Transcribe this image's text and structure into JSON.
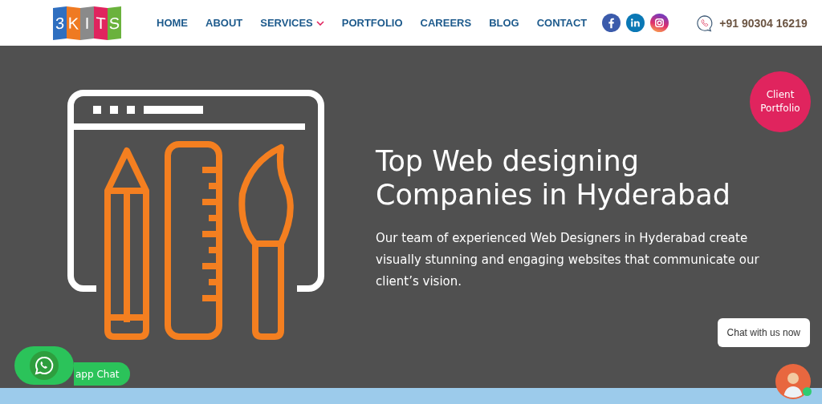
{
  "header": {
    "logo_letters": [
      "3",
      "K",
      "I",
      "T",
      "S"
    ],
    "nav": [
      {
        "label": "HOME",
        "has_dropdown": false
      },
      {
        "label": "ABOUT",
        "has_dropdown": false
      },
      {
        "label": "SERVICES",
        "has_dropdown": true
      },
      {
        "label": "PORTFOLIO",
        "has_dropdown": false
      },
      {
        "label": "CAREERS",
        "has_dropdown": false
      },
      {
        "label": "BLOG",
        "has_dropdown": false
      },
      {
        "label": "CONTACT",
        "has_dropdown": false
      }
    ],
    "social": [
      {
        "kind": "facebook"
      },
      {
        "kind": "linkedin"
      },
      {
        "kind": "instagram"
      }
    ],
    "phone": "+91 90304 16219"
  },
  "hero": {
    "title": "Top Web designing Companies in Hyderabad",
    "text": "Our team of experienced Web Designers in Hyderabad create visually stunning and engaging websites that communicate our client’s vision.",
    "badge": "Client Portfolio"
  },
  "whatsapp": {
    "label": "app Chat"
  },
  "chat": {
    "prompt": "Chat with us now",
    "online": true
  }
}
